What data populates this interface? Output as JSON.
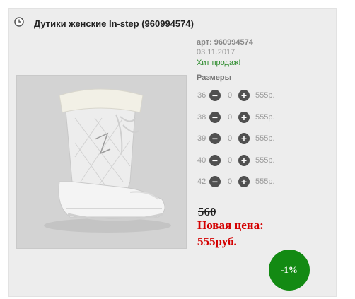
{
  "product": {
    "title": "Дутики женские In-step (960994574)",
    "article": "арт: 960994574",
    "date": "03.11.2017",
    "badge": "Хит продаж!",
    "image_alt": "white boot"
  },
  "sizes": {
    "label": "Размеры",
    "rows": [
      {
        "size": "36",
        "qty": "0",
        "price": "555р."
      },
      {
        "size": "38",
        "qty": "0",
        "price": "555р."
      },
      {
        "size": "39",
        "qty": "0",
        "price": "555р."
      },
      {
        "size": "40",
        "qty": "0",
        "price": "555р."
      },
      {
        "size": "42",
        "qty": "0",
        "price": "555р."
      }
    ]
  },
  "pricing": {
    "old_price": "560",
    "new_label": "Новая цена:",
    "new_price": "555руб.",
    "discount": "-1%"
  },
  "colors": {
    "accent_red": "#d40000",
    "discount_green": "#138a13",
    "hit_green": "#2a8a2a"
  },
  "icons": {
    "title": "clock-icon",
    "minus": "minus-circle-icon",
    "plus": "plus-circle-icon"
  }
}
